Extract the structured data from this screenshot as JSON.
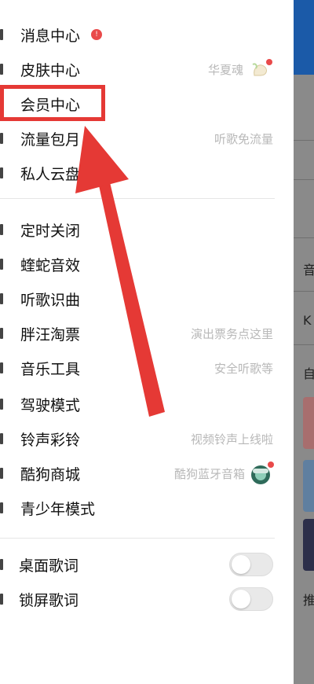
{
  "menu_group1": [
    {
      "label": "消息中心",
      "badge": "!"
    },
    {
      "label": "皮肤中心",
      "hint": "华夏魂"
    },
    {
      "label": "会员中心"
    },
    {
      "label": "流量包月",
      "hint": "听歌免流量"
    },
    {
      "label": "私人云盘"
    }
  ],
  "menu_group2": [
    {
      "label": "定时关闭"
    },
    {
      "label": "蝰蛇音效"
    },
    {
      "label": "听歌识曲"
    },
    {
      "label": "胖汪淘票",
      "hint": "演出票务点这里"
    },
    {
      "label": "音乐工具",
      "hint": "安全听歌等"
    },
    {
      "label": "驾驶模式"
    },
    {
      "label": "铃声彩铃",
      "hint": "视频铃声上线啦"
    },
    {
      "label": "酷狗商城",
      "hint": "酷狗蓝牙音箱"
    },
    {
      "label": "青少年模式"
    }
  ],
  "toggles": [
    {
      "label": "桌面歌词",
      "on": false
    },
    {
      "label": "锁屏歌词",
      "on": false
    }
  ],
  "backdrop": {
    "t1": "音",
    "t2": "K",
    "t3": "自",
    "t4": "推"
  },
  "colors": {
    "highlight": "#e53935",
    "badge": "#e94a4a"
  }
}
